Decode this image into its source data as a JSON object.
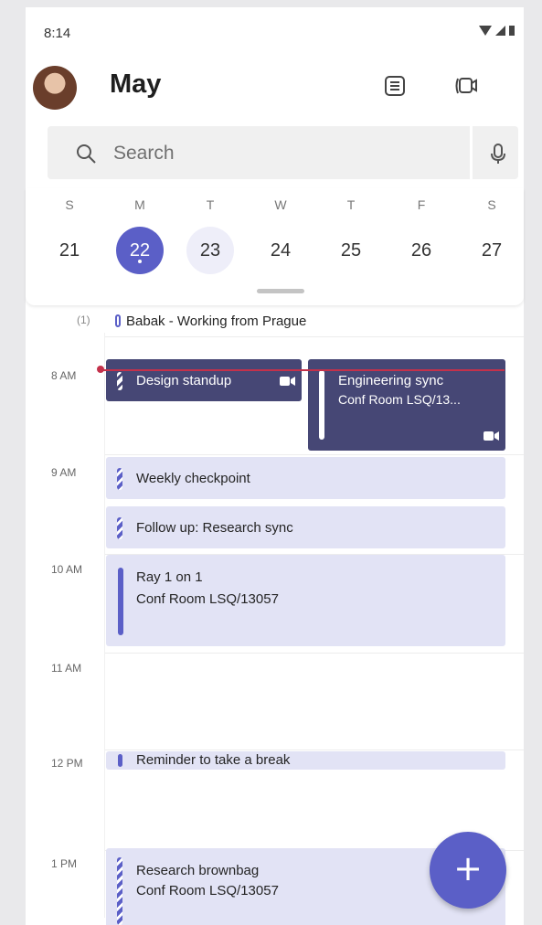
{
  "status_bar": {
    "time": "8:14"
  },
  "header": {
    "title": "May"
  },
  "search": {
    "placeholder": "Search"
  },
  "week": {
    "days": [
      {
        "letter": "S",
        "date": "21"
      },
      {
        "letter": "M",
        "date": "22"
      },
      {
        "letter": "T",
        "date": "23"
      },
      {
        "letter": "W",
        "date": "24"
      },
      {
        "letter": "T",
        "date": "25"
      },
      {
        "letter": "F",
        "date": "26"
      },
      {
        "letter": "S",
        "date": "27"
      }
    ],
    "selected_date": "22",
    "today_date": "23"
  },
  "all_day": {
    "count": "(1)",
    "event": "Babak - Working from Prague"
  },
  "time_labels": [
    "8 AM",
    "9 AM",
    "10 AM",
    "11 AM",
    "12 PM",
    "1 PM"
  ],
  "events": [
    {
      "title": "Design standup",
      "subtitle": ""
    },
    {
      "title": "Engineering sync",
      "subtitle": "Conf Room LSQ/13..."
    },
    {
      "title": "Weekly checkpoint",
      "subtitle": ""
    },
    {
      "title": "Follow up: Research sync",
      "subtitle": ""
    },
    {
      "title": "Ray 1 on 1",
      "subtitle": "Conf Room LSQ/13057"
    },
    {
      "title": "Reminder to take a break",
      "subtitle": ""
    },
    {
      "title": "Research brownbag",
      "subtitle": "Conf Room LSQ/13057"
    }
  ],
  "fab": {
    "label": "+"
  },
  "colors": {
    "accent": "#5b5fc7",
    "event_dark": "#464775",
    "event_light": "#e2e3f5",
    "now_line": "#c4314b"
  },
  "icons": [
    "wifi-icon",
    "signal-icon",
    "battery-icon",
    "agenda-view-icon",
    "meet-now-icon",
    "search-icon",
    "microphone-icon",
    "video-call-icon",
    "add-icon"
  ]
}
